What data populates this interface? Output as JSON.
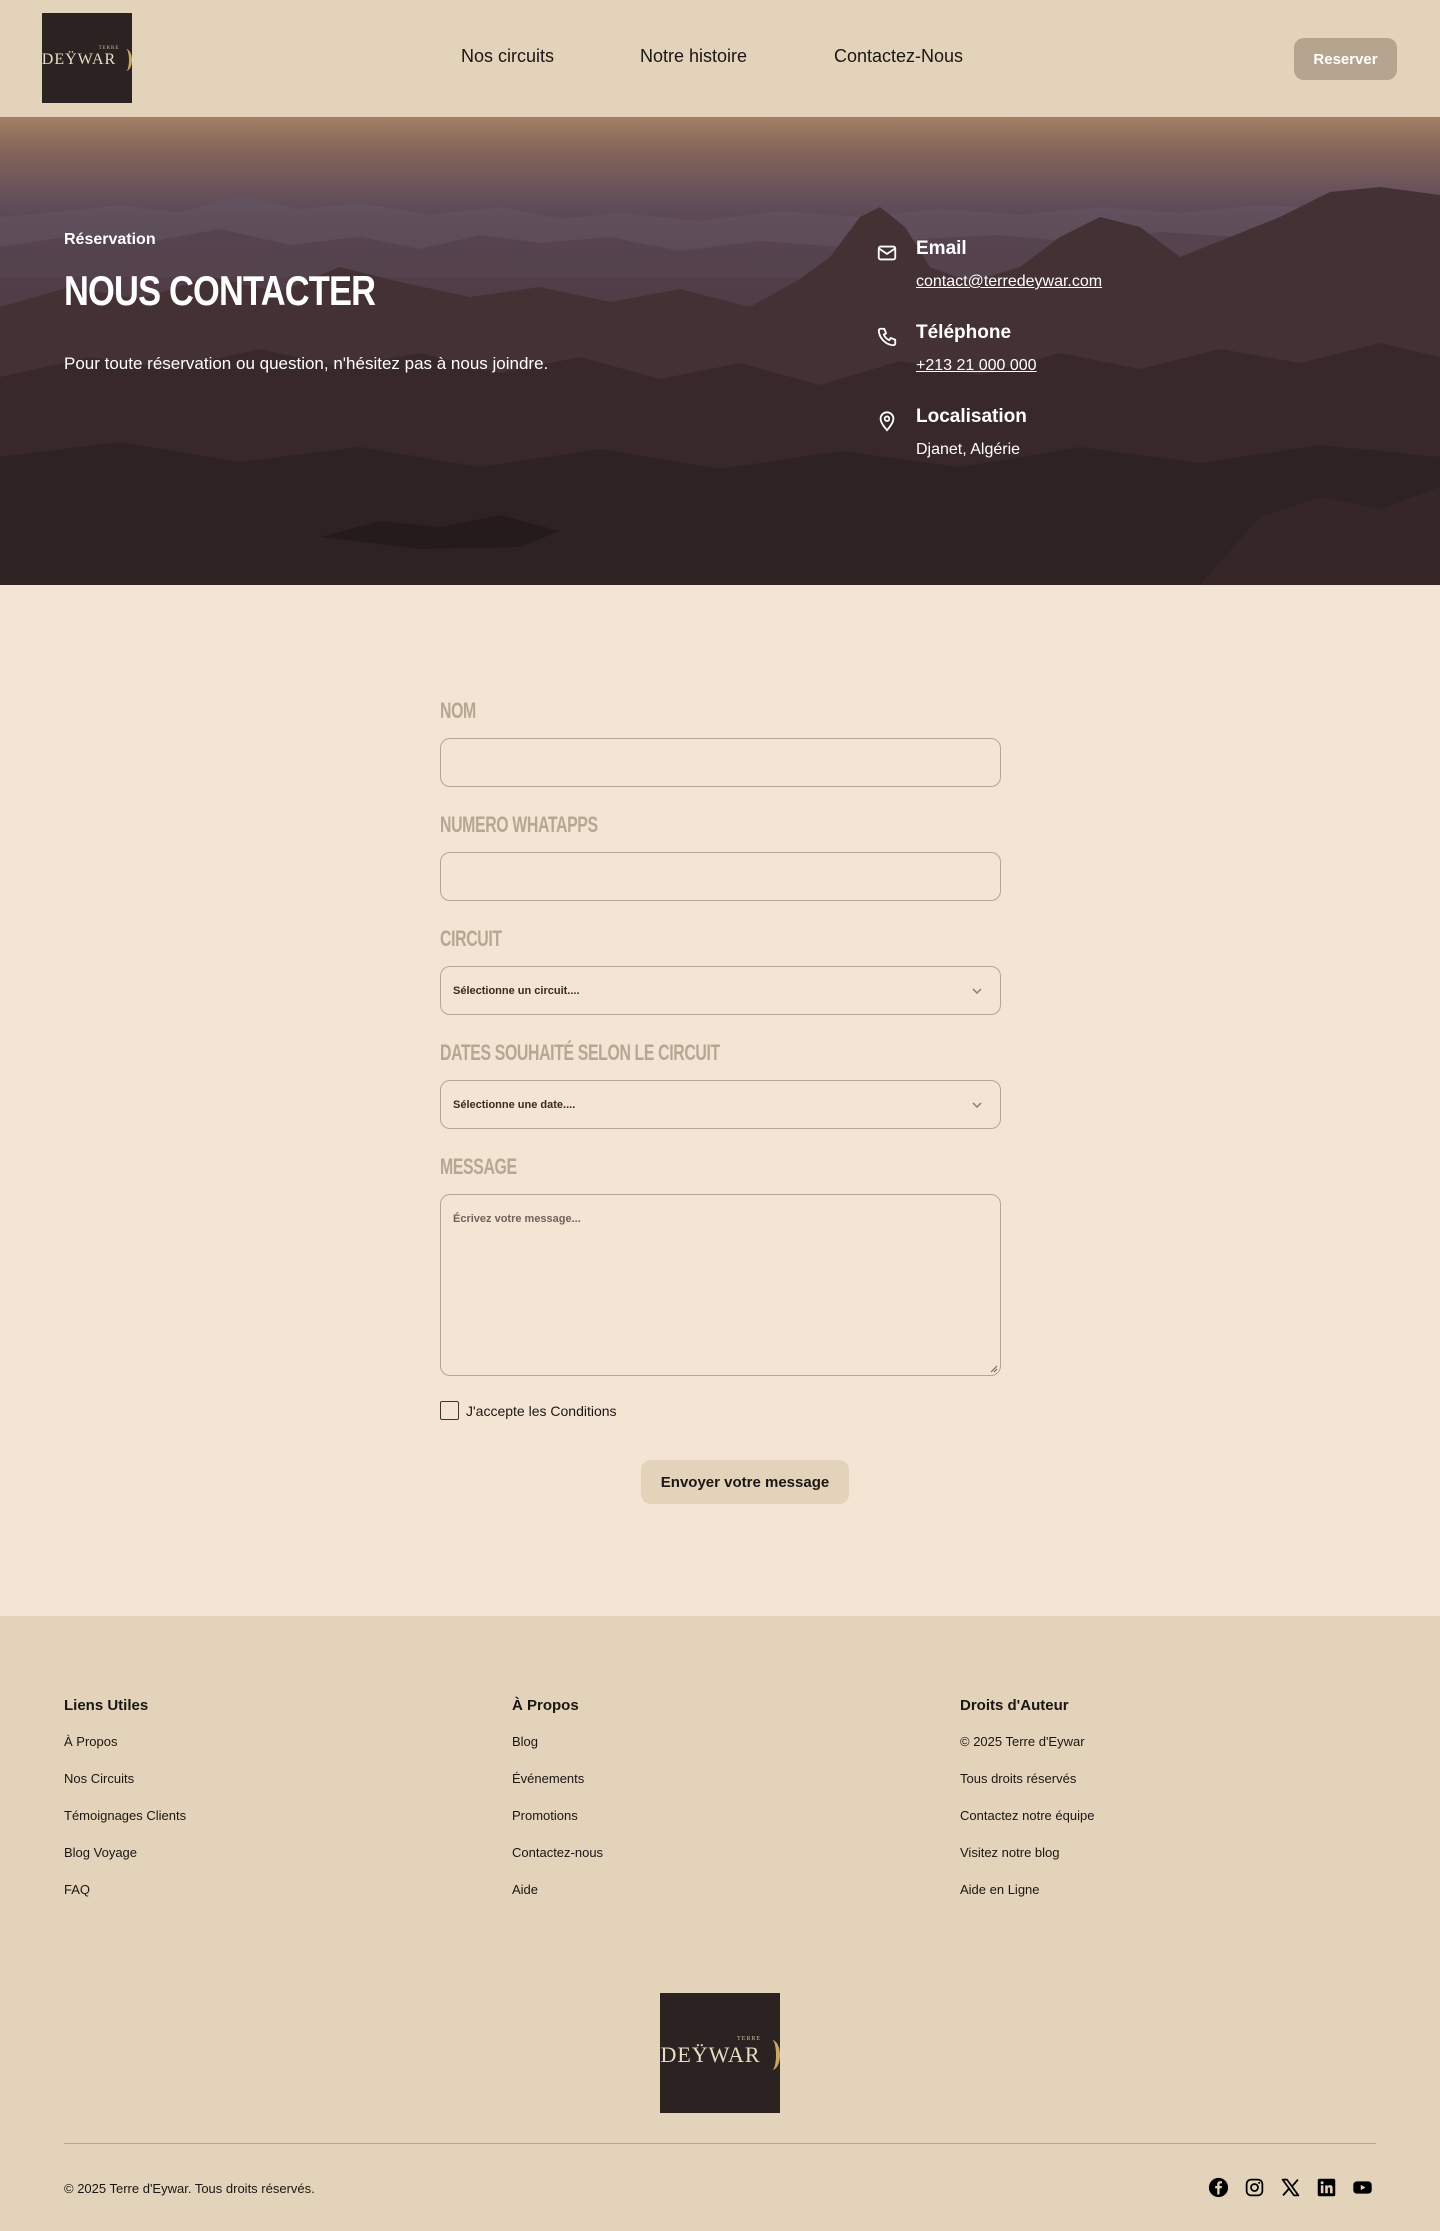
{
  "header": {
    "logo": {
      "top_text": "TERRE",
      "main_text": "DEŸWAR"
    },
    "nav": [
      "Nos circuits",
      "Notre histoire",
      "Contactez-Nous"
    ],
    "reserve_label": "Reserver"
  },
  "hero": {
    "eyebrow": "Réservation",
    "title": "NOUS CONTACTER",
    "subtitle": "Pour toute réservation ou question, n'hésitez pas à nous joindre.",
    "contacts": [
      {
        "icon": "mail-icon",
        "label": "Email",
        "value": "contact@terredeywar.com"
      },
      {
        "icon": "phone-icon",
        "label": "Téléphone",
        "value": "+213 21 000 000"
      },
      {
        "icon": "location-pin-icon",
        "label": "Localisation",
        "value": "Djanet, Algérie"
      }
    ]
  },
  "form": {
    "name_label": "NOM",
    "name_value": "",
    "whatsapp_label": "NUMERO WHATAPPS",
    "whatsapp_value": "",
    "circuit_label": "CIRCUIT",
    "circuit_placeholder": "Sélectionne un circuit....",
    "dates_label": "DATES SOUHAITÉ SELON LE CIRCUIT",
    "dates_placeholder": "Sélectionne une date....",
    "message_label": "MESSAGE",
    "message_placeholder": "Écrivez votre message...",
    "terms_label": "J'accepte les Conditions",
    "terms_checked": false,
    "submit_label": "Envoyer votre message"
  },
  "footer": {
    "columns": [
      {
        "title": "Liens Utiles",
        "items": [
          "À Propos",
          "Nos Circuits",
          "Témoignages Clients",
          "Blog Voyage",
          "FAQ"
        ]
      },
      {
        "title": "À Propos",
        "items": [
          "Blog",
          "Événements",
          "Promotions",
          "Contactez-nous",
          "Aide"
        ]
      },
      {
        "title": "Droits d'Auteur",
        "items": [
          "© 2025 Terre d'Eywar",
          "Tous droits réservés",
          "Contactez notre équipe",
          "Visitez notre blog",
          "Aide en Ligne"
        ]
      }
    ],
    "copyright": "© 2025 Terre d'Eywar. Tous droits réservés.",
    "socials": [
      "facebook-icon",
      "instagram-icon",
      "x-icon",
      "linkedin-icon",
      "youtube-icon"
    ]
  },
  "colors": {
    "header_bg": "#e3d3ba",
    "page_bg": "#f3e4d3",
    "reserve_button": "#b5a48e",
    "logo_bg": "#2b2321",
    "label_muted": "#b6a694"
  }
}
